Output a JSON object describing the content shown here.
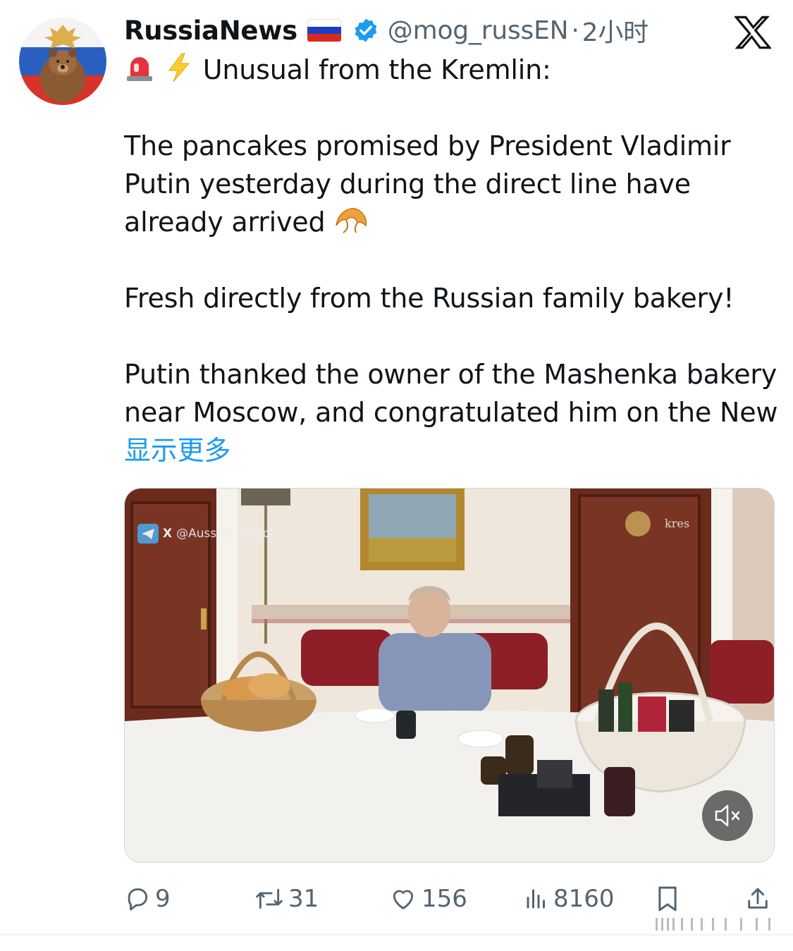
{
  "author": {
    "display_name": "RussiaNews",
    "handle": "@mog_russEN",
    "time_separator": "·",
    "time_ago": "2小时",
    "flag_icon": "russia-flag-icon",
    "verified_icon": "verified-badge-icon"
  },
  "tweet": {
    "line1": "Unusual from the Kremlin:",
    "para1": "The pancakes promised by President Vladimir Putin yesterday during the direct line have already arrived",
    "para2": "Fresh directly from the Russian family bakery!",
    "para3": "Putin thanked the owner of the Mashenka bakery near Moscow, and congratulated him on the New",
    "show_more": "显示更多"
  },
  "media": {
    "watermark": "@AussieCossack",
    "watermark_x": "X",
    "corner_text": "kres",
    "mute_icon": "speaker-muted-icon"
  },
  "actions": {
    "replies": "9",
    "reposts": "31",
    "likes": "156",
    "views": "8160"
  },
  "colors": {
    "accent": "#1d9bf0",
    "muted_text": "#536471",
    "text": "#0f1419"
  }
}
